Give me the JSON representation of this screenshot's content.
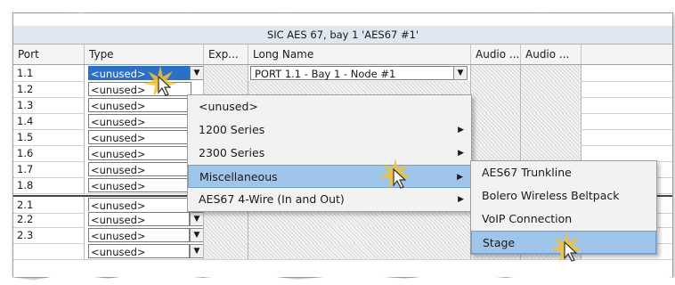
{
  "grid_title": "SIC AES 67, bay 1 'AES67 #1'",
  "columns": [
    "Port",
    "Type",
    "Exp...",
    "Long Name",
    "Audio ...",
    "Audio ..."
  ],
  "rows": [
    {
      "port": "1.1",
      "type": "<unused>",
      "long_name": "PORT 1.1 - Bay 1 - Node #1"
    },
    {
      "port": "1.2",
      "type": "<unused>"
    },
    {
      "port": "1.3",
      "type": "<unused>"
    },
    {
      "port": "1.4",
      "type": "<unused>"
    },
    {
      "port": "1.5",
      "type": "<unused>"
    },
    {
      "port": "1.6",
      "type": "<unused>"
    },
    {
      "port": "1.7",
      "type": "<unused>"
    },
    {
      "port": "1.8",
      "type": "<unused>"
    },
    {
      "port": "2.1",
      "type": "<unused>"
    },
    {
      "port": "2.2",
      "type": "<unused>"
    },
    {
      "port": "2.3",
      "type": "<unused>"
    },
    {
      "port": "",
      "type": "<unused>"
    }
  ],
  "menu": {
    "items": [
      "<unused>",
      "1200 Series",
      "2300 Series",
      "Miscellaneous",
      "AES67 4-Wire (In and Out)"
    ]
  },
  "submenu": {
    "items": [
      "AES67 Trunkline",
      "Bolero Wireless Beltpack",
      "VoIP Connection",
      "Stage"
    ]
  },
  "icons": {
    "dropdown": "chevron-down-icon",
    "submenu_arrow": "chevron-right-icon",
    "cursor": "mouse-pointer-icon"
  },
  "colors": {
    "title_bg": "#dfe7f1",
    "menu_highlight": "#9fc5ea",
    "click_burst": "#f2c230"
  }
}
